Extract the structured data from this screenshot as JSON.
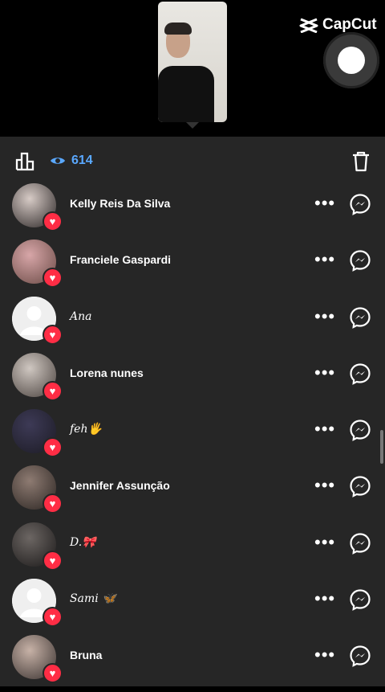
{
  "app_brand": "CapCut",
  "viewer": {
    "count": "614"
  },
  "viewers": [
    {
      "name": "Kelly Reis Da Silva",
      "avatar": "photo",
      "colors": [
        "#d7cbc6",
        "#2b2626"
      ]
    },
    {
      "name": "Franciele Gaspardi",
      "avatar": "photo",
      "colors": [
        "#d7a6a8",
        "#6a4a45"
      ]
    },
    {
      "name": "𝐴𝑛𝑎",
      "avatar": "default",
      "colors": [
        "#ededed",
        "#c9c9c9"
      ],
      "script": true
    },
    {
      "name": "Lorena nunes",
      "avatar": "photo",
      "colors": [
        "#cfc7c1",
        "#4a423e"
      ]
    },
    {
      "name": "feh🖐",
      "avatar": "photo",
      "colors": [
        "#3d3a56",
        "#1c1b24"
      ],
      "script": true
    },
    {
      "name": "Jennifer Assunção",
      "avatar": "photo",
      "colors": [
        "#8e7b72",
        "#2b2522"
      ]
    },
    {
      "name": "D.🎀",
      "avatar": "photo",
      "colors": [
        "#6c6663",
        "#1b1919"
      ],
      "script": true
    },
    {
      "name": "Sami 🦋",
      "avatar": "default",
      "colors": [
        "#ededed",
        "#c9c9c9"
      ],
      "script": true
    },
    {
      "name": "Bruna",
      "avatar": "photo",
      "colors": [
        "#c7b2a7",
        "#3a3230"
      ]
    }
  ],
  "colors": {
    "accent": "#5aa8ff",
    "heart": "#ff2d45",
    "sheet": "#262626"
  }
}
